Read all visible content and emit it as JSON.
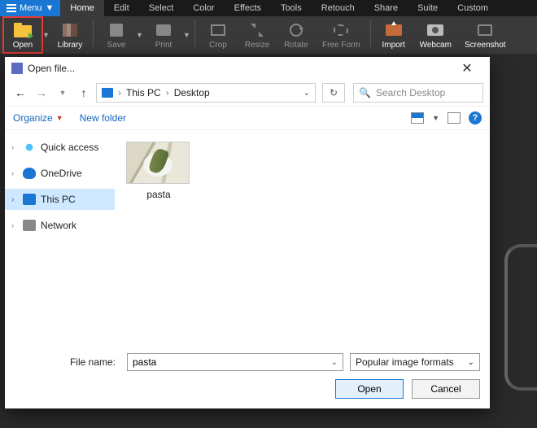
{
  "menubar": {
    "menu_label": "Menu",
    "tabs": [
      "Home",
      "Edit",
      "Select",
      "Color",
      "Effects",
      "Tools",
      "Retouch",
      "Share",
      "Suite",
      "Custom"
    ],
    "active_tab": "Home"
  },
  "ribbon": {
    "open": "Open",
    "library": "Library",
    "save": "Save",
    "print": "Print",
    "crop": "Crop",
    "resize": "Resize",
    "rotate": "Rotate",
    "freeform": "Free Form",
    "import": "Import",
    "webcam": "Webcam",
    "screenshot": "Screenshot"
  },
  "dialog": {
    "title": "Open file...",
    "breadcrumb": {
      "root": "This PC",
      "folder": "Desktop"
    },
    "search_placeholder": "Search Desktop",
    "toolbar": {
      "organize": "Organize",
      "newfolder": "New folder"
    },
    "tree": {
      "quick": "Quick access",
      "onedrive": "OneDrive",
      "thispc": "This PC",
      "network": "Network"
    },
    "file": {
      "name": "pasta"
    },
    "footer": {
      "label": "File name:",
      "value": "pasta",
      "filter": "Popular image formats",
      "open": "Open",
      "cancel": "Cancel"
    }
  }
}
